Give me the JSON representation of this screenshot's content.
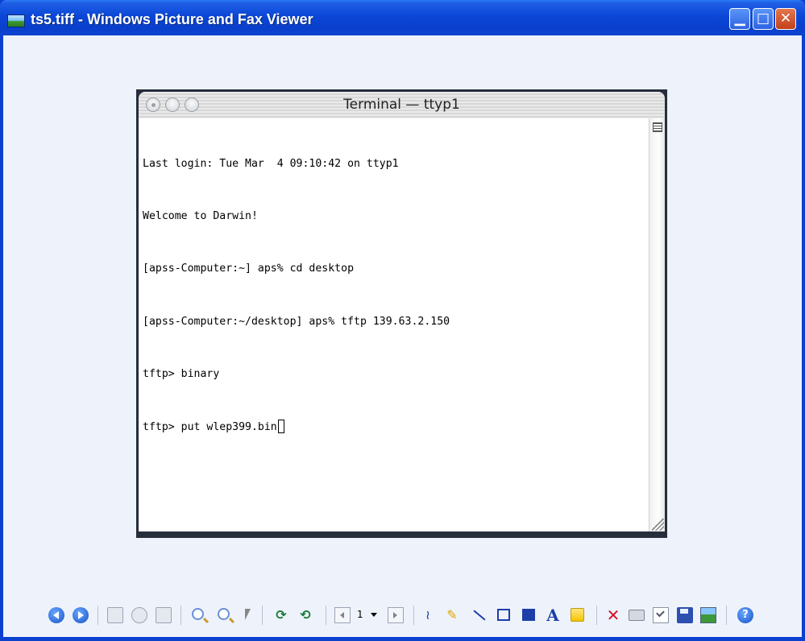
{
  "window": {
    "title": "ts5.tiff - Windows Picture and Fax Viewer",
    "controls": {
      "minimize": "▁",
      "maximize": "□",
      "close": "✕"
    }
  },
  "image": {
    "terminal_title": "Terminal — ttyp1",
    "lines": [
      "Last login: Tue Mar  4 09:10:42 on ttyp1",
      "Welcome to Darwin!",
      "[apss-Computer:~] aps% cd desktop",
      "[apss-Computer:~/desktop] aps% tftp 139.63.2.150",
      "tftp> binary",
      "tftp> put wlep399.bin"
    ]
  },
  "toolbar": {
    "page_number": "1",
    "icons": [
      "previous-image-icon",
      "next-image-icon",
      "best-fit-icon",
      "actual-size-icon",
      "slideshow-icon",
      "zoom-in-icon",
      "zoom-out-icon",
      "select-icon",
      "rotate-clockwise-icon",
      "rotate-counterclockwise-icon",
      "previous-page-icon",
      "page-dropdown-icon",
      "next-page-icon",
      "freehand-annotation-icon",
      "highlight-icon",
      "straight-line-icon",
      "hollow-rectangle-icon",
      "filled-rectangle-icon",
      "text-icon",
      "attached-note-icon",
      "delete-icon",
      "print-icon",
      "properties-icon",
      "save-icon",
      "edit-image-icon",
      "help-icon"
    ]
  },
  "colors": {
    "titlebar": "#0b46d6",
    "client_bg": "#eef3fb",
    "accent": "#1c3ea8"
  }
}
